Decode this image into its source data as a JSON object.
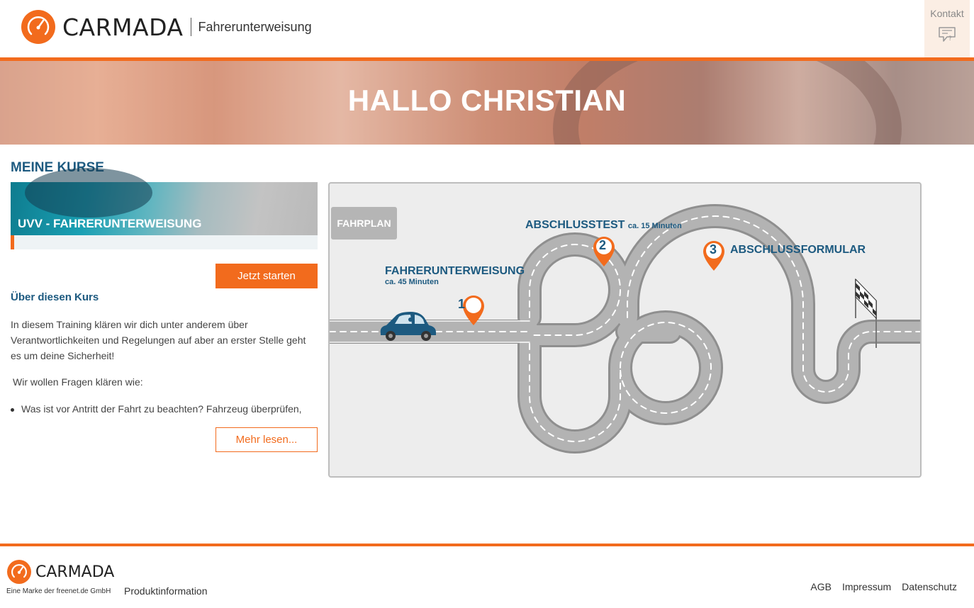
{
  "colors": {
    "brand_orange": "#f26b1d",
    "brand_blue": "#1d5a80"
  },
  "header": {
    "logo_text": "CARMADA",
    "logo_sub": "Fahrerunterweisung",
    "kontakt_label": "Kontakt",
    "kontakt_icon": "chat-question-icon"
  },
  "hero": {
    "title": "HALLO CHRISTIAN"
  },
  "main": {
    "section_title": "MEINE KURSE",
    "course": {
      "title": "UVV - FAHRERUNTERWEISUNG",
      "start_button": "Jetzt starten",
      "about_title": "Über diesen Kurs",
      "about_text": "In diesem Training klären wir dich unter anderem über Verantwortlichkeiten und Regelungen auf aber an erster Stelle geht es um deine Sicherheit!",
      "about_question": "Wir wollen Fragen klären wie:",
      "about_bullet": "Was ist vor Antritt der Fahrt zu beachten? Fahrzeug überprüfen,",
      "more_button": "Mehr lesen..."
    }
  },
  "fahrplan": {
    "tag": "FAHRPLAN",
    "stages": [
      {
        "number": "1",
        "title": "FAHRERUNTERWEISUNG",
        "duration": "ca. 45 Minuten"
      },
      {
        "number": "2",
        "title": "ABSCHLUSSTEST",
        "duration": "ca. 15 Minuten"
      },
      {
        "number": "3",
        "title": "ABSCHLUSSFORMULAR",
        "duration": ""
      }
    ]
  },
  "footer": {
    "logo_text": "CARMADA",
    "tagline": "Eine Marke der freenet.de GmbH",
    "product_link": "Produktinformation",
    "links": [
      "AGB",
      "Impressum",
      "Datenschutz"
    ]
  }
}
